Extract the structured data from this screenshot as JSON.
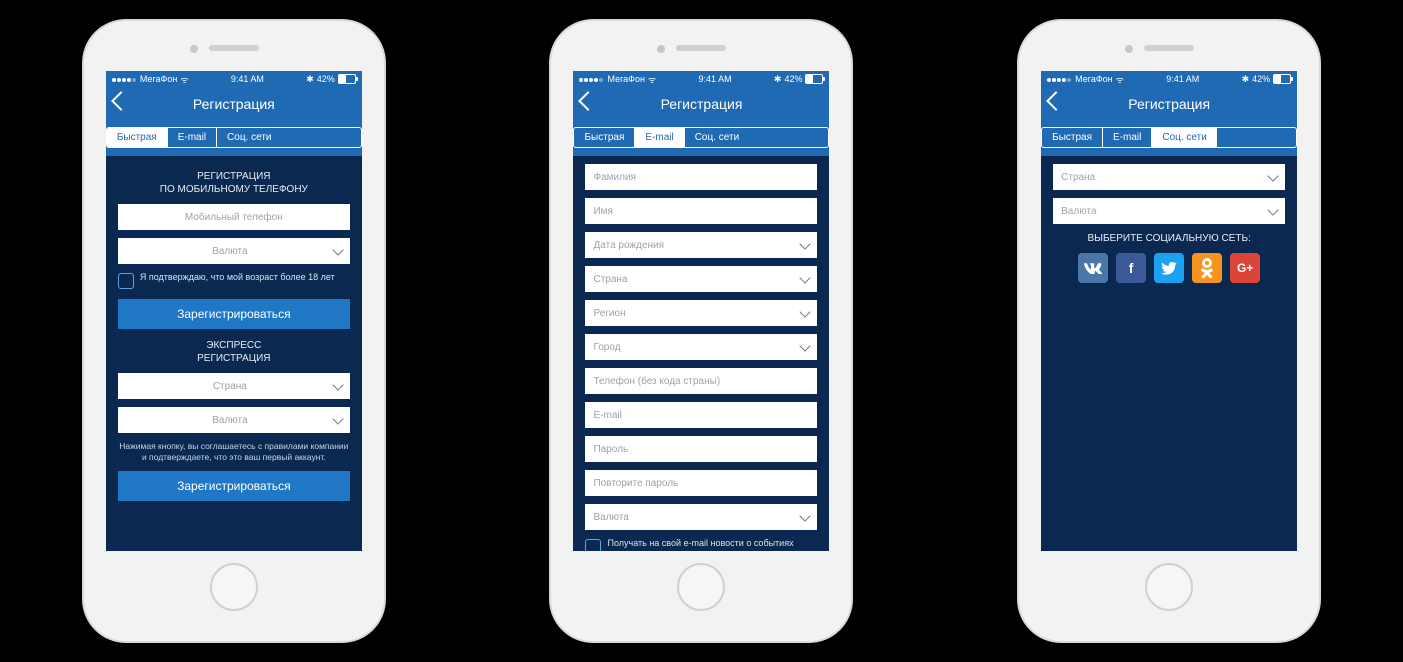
{
  "status": {
    "carrier": "МегаФон",
    "time": "9:41 AM",
    "battery": "42%",
    "bt": "✱"
  },
  "nav": {
    "title": "Регистрация"
  },
  "tabs": {
    "fast": "Быстрая",
    "email": "E-mail",
    "social": "Соц. сети"
  },
  "screen1": {
    "section1_header": "РЕГИСТРАЦИЯ\nПО МОБИЛЬНОМУ ТЕЛЕФОНУ",
    "phone_ph": "Мобильный телефон",
    "currency_ph": "Валюта",
    "age_confirm": "Я подтверждаю, что мой возраст более 18 лет",
    "submit": "Зарегистрироваться",
    "section2_header": "ЭКСПРЕСС\nРЕГИСТРАЦИЯ",
    "country_ph": "Страна",
    "currency2_ph": "Валюта",
    "legal": "Нажимая кнопку, вы соглашаетесь с правилами компании и подтверждаете, что это ваш первый аккаунт.",
    "submit2": "Зарегистрироваться"
  },
  "screen2": {
    "lastname_ph": "Фамилия",
    "firstname_ph": "Имя",
    "dob_ph": "Дата рождения",
    "country_ph": "Страна",
    "region_ph": "Регион",
    "city_ph": "Город",
    "phone_ph": "Телефон (без кода страны)",
    "email_ph": "E-mail",
    "password_ph": "Пароль",
    "password2_ph": "Повторите пароль",
    "currency_ph": "Валюта",
    "newsletter": "Получать на свой e-mail новости о событиях"
  },
  "screen3": {
    "country_ph": "Страна",
    "currency_ph": "Валюта",
    "choose_label": "ВЫБЕРИТЕ СОЦИАЛЬНУЮ СЕТЬ:",
    "icons": {
      "vk": "w",
      "fb": "f",
      "tw": "t",
      "ok": "♪",
      "gp": "G+"
    }
  }
}
